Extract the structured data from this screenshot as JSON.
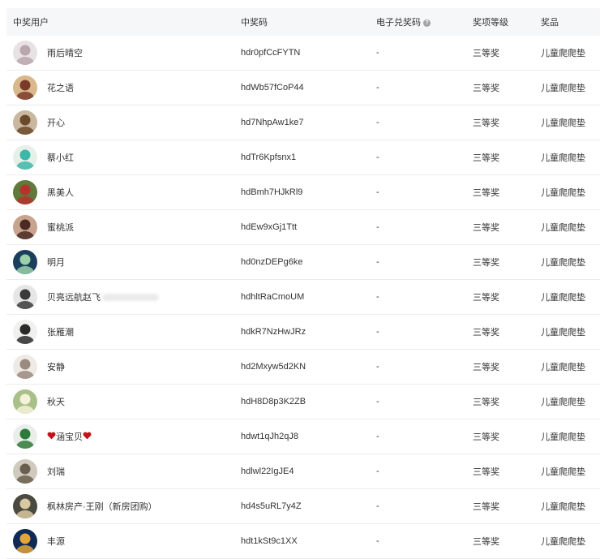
{
  "columns": {
    "user": "中奖用户",
    "code": "中奖码",
    "ecode": "电子兑奖码",
    "level": "奖项等级",
    "prize": "奖品"
  },
  "rows": [
    {
      "name": "雨后晴空",
      "code": "hdr0pfCcFYTN",
      "ecode": "-",
      "level": "三等奖",
      "prize": "儿童爬爬垫",
      "avatar": [
        "#e8e2e4",
        "#b9a7ad"
      ]
    },
    {
      "name": "花之语",
      "code": "hdWb57fCoP44",
      "ecode": "-",
      "level": "三等奖",
      "prize": "儿童爬爬垫",
      "avatar": [
        "#d9b88c",
        "#7a3a2a"
      ]
    },
    {
      "name": "开心",
      "code": "hd7NhpAw1ke7",
      "ecode": "-",
      "level": "三等奖",
      "prize": "儿童爬爬垫",
      "avatar": [
        "#c9b7a0",
        "#6b4a2a"
      ]
    },
    {
      "name": "蔡小红",
      "code": "hdTr6Kpfsnx1",
      "ecode": "-",
      "level": "三等奖",
      "prize": "儿童爬爬垫",
      "avatar": [
        "#e7efe9",
        "#3cb7a8"
      ]
    },
    {
      "name": "黑美人",
      "code": "hdBmh7HJkRl9",
      "ecode": "-",
      "level": "三等奖",
      "prize": "儿童爬爬垫",
      "avatar": [
        "#5f7a3a",
        "#b5332b"
      ]
    },
    {
      "name": "蜜桃派",
      "code": "hdEw9xGj1Ttt",
      "ecode": "-",
      "level": "三等奖",
      "prize": "儿童爬爬垫",
      "avatar": [
        "#c8a38d",
        "#4a2a22"
      ]
    },
    {
      "name": "明月",
      "code": "hd0nzDEPg6ke",
      "ecode": "-",
      "level": "三等奖",
      "prize": "儿童爬爬垫",
      "avatar": [
        "#1a3f5c",
        "#9ad1a8"
      ]
    },
    {
      "name": "贝亮远航赵飞",
      "code": "hdhltRaCmoUM",
      "ecode": "-",
      "level": "三等奖",
      "prize": "儿童爬爬垫",
      "avatar": [
        "#e6e6e6",
        "#3a3a3a"
      ]
    },
    {
      "name": "张雁潮",
      "code": "hdkR7NzHwJRz",
      "ecode": "-",
      "level": "三等奖",
      "prize": "儿童爬爬垫",
      "avatar": [
        "#f0f0ee",
        "#2a2a2a"
      ]
    },
    {
      "name": "安静",
      "code": "hd2Mxyw5d2KN",
      "ecode": "-",
      "level": "三等奖",
      "prize": "儿童爬爬垫",
      "avatar": [
        "#eeeae6",
        "#9a8a80"
      ]
    },
    {
      "name": "秋天",
      "code": "hdH8D8p3K2ZB",
      "ecode": "-",
      "level": "三等奖",
      "prize": "儿童爬爬垫",
      "avatar": [
        "#a9c08a",
        "#f4f2d8"
      ]
    },
    {
      "name": "涵宝贝",
      "code": "hdwt1qJh2qJ8",
      "ecode": "-",
      "level": "三等奖",
      "prize": "儿童爬爬垫",
      "avatar": [
        "#eaeeea",
        "#2e7a3a"
      ]
    },
    {
      "name": "刘瑞",
      "code": "hdlwl22IgJE4",
      "ecode": "-",
      "level": "三等奖",
      "prize": "儿童爬爬垫",
      "avatar": [
        "#cfc9be",
        "#6a5f4e"
      ]
    },
    {
      "name": "枫林房产·王刚（新房团购）",
      "code": "hd4s5uRL7y4Z",
      "ecode": "-",
      "level": "三等奖",
      "prize": "儿童爬爬垫",
      "avatar": [
        "#4a4a40",
        "#d9c8a0"
      ]
    },
    {
      "name": "丰源",
      "code": "hdt1kSt9c1XX",
      "ecode": "-",
      "level": "三等奖",
      "prize": "儿童爬爬垫",
      "avatar": [
        "#0e2a55",
        "#e2a53a"
      ]
    }
  ]
}
